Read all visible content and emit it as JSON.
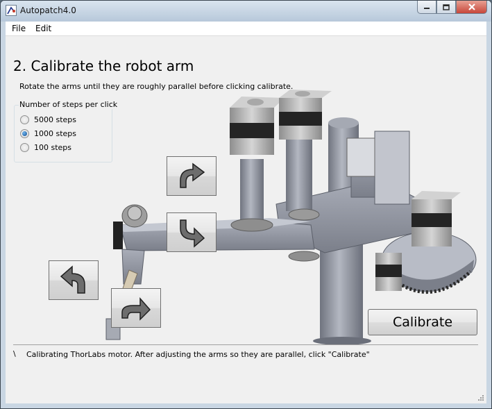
{
  "window": {
    "title": "Autopatch4.0",
    "minimize_icon": "minimize-icon",
    "maximize_icon": "maximize-icon",
    "close_icon": "close-icon"
  },
  "menu": [
    "File",
    "Edit"
  ],
  "step": {
    "heading": "2. Calibrate the robot arm",
    "instruction": "Rotate the arms until they are roughly parallel before clicking calibrate."
  },
  "steps_group": {
    "label": "Number of steps per click",
    "options": [
      {
        "label": "5000 steps",
        "selected": false
      },
      {
        "label": "1000 steps",
        "selected": true
      },
      {
        "label": "100 steps",
        "selected": false
      }
    ]
  },
  "controls": {
    "upper_cw_icon": "rotate-clockwise-arrow-icon",
    "upper_ccw_icon": "rotate-counterclockwise-arrow-icon",
    "lower_ccw_icon": "rotate-counterclockwise-arrow-icon",
    "lower_cw_icon": "rotate-clockwise-arrow-icon",
    "calibrate_label": "Calibrate"
  },
  "status": {
    "spinner": "\\",
    "message": "Calibrating ThorLabs motor.  After adjusting the arms so they are parallel, click \"Calibrate\""
  }
}
